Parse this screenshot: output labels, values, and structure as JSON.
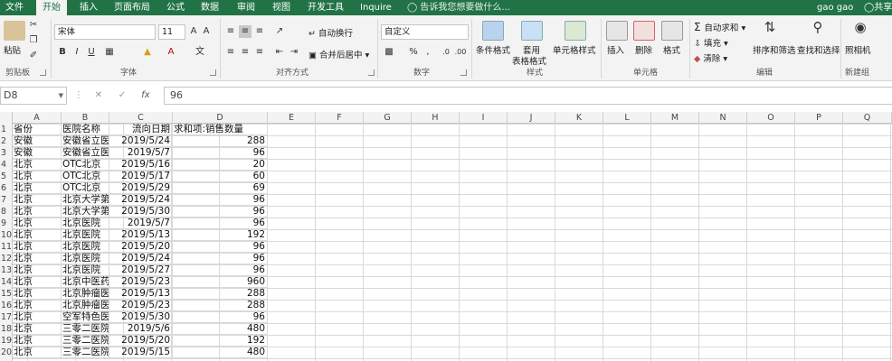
{
  "tabs": [
    "文件",
    "开始",
    "插入",
    "页面布局",
    "公式",
    "数据",
    "审阅",
    "视图",
    "开发工具",
    "Inquire"
  ],
  "tell_me": "告诉我您想要做什么...",
  "user": "gao gao",
  "share": "共享",
  "ribbon": {
    "paste": "粘贴",
    "clipboard": "剪贴板",
    "font_name": "宋体",
    "font_size": "11",
    "font_group": "字体",
    "align_group": "对齐方式",
    "wrap_text": "自动换行",
    "merge_center": "合并后居中",
    "number_format": "自定义",
    "number_group": "数字",
    "conditional": "条件格式",
    "table_fmt_1": "套用",
    "table_fmt_2": "表格格式",
    "cell_styles": "单元格样式",
    "styles_group": "样式",
    "insert": "插入",
    "delete": "删除",
    "format": "格式",
    "cells_group": "单元格",
    "autosum": "自动求和",
    "fill": "填充",
    "clear": "清除",
    "sort_filter": "排序和筛选",
    "find_select": "查找和选择",
    "editing_group": "编辑",
    "camera": "照相机",
    "newgroup": "新建组"
  },
  "namebox": "D8",
  "formula_value": "96",
  "columns": [
    "A",
    "B",
    "C",
    "D",
    "E",
    "F",
    "G",
    "H",
    "I",
    "J",
    "K",
    "L",
    "M",
    "N",
    "O",
    "P",
    "Q"
  ],
  "rows": [
    {
      "n": "1",
      "a": "省份",
      "b": "医院名称",
      "c": "流向日期",
      "d": "求和项:销售数量"
    },
    {
      "n": "2",
      "a": "安徽",
      "b": "安徽省立医",
      "c": "2019/5/24",
      "d": "288"
    },
    {
      "n": "3",
      "a": "安徽",
      "b": "安徽省立医",
      "c": "2019/5/7",
      "d": "96"
    },
    {
      "n": "4",
      "a": "北京",
      "b": "OTC北京",
      "c": "2019/5/16",
      "d": "20"
    },
    {
      "n": "5",
      "a": "北京",
      "b": "OTC北京",
      "c": "2019/5/17",
      "d": "60"
    },
    {
      "n": "6",
      "a": "北京",
      "b": "OTC北京",
      "c": "2019/5/29",
      "d": "69"
    },
    {
      "n": "7",
      "a": "北京",
      "b": "北京大学第",
      "c": "2019/5/24",
      "d": "96"
    },
    {
      "n": "8",
      "a": "北京",
      "b": "北京大学第",
      "c": "2019/5/30",
      "d": "96"
    },
    {
      "n": "9",
      "a": "北京",
      "b": "北京医院",
      "c": "2019/5/7",
      "d": "96"
    },
    {
      "n": "10",
      "a": "北京",
      "b": "北京医院",
      "c": "2019/5/13",
      "d": "192"
    },
    {
      "n": "11",
      "a": "北京",
      "b": "北京医院",
      "c": "2019/5/20",
      "d": "96"
    },
    {
      "n": "12",
      "a": "北京",
      "b": "北京医院",
      "c": "2019/5/24",
      "d": "96"
    },
    {
      "n": "13",
      "a": "北京",
      "b": "北京医院",
      "c": "2019/5/27",
      "d": "96"
    },
    {
      "n": "14",
      "a": "北京",
      "b": "北京中医药",
      "c": "2019/5/23",
      "d": "960"
    },
    {
      "n": "15",
      "a": "北京",
      "b": "北京肿瘤医",
      "c": "2019/5/13",
      "d": "288"
    },
    {
      "n": "16",
      "a": "北京",
      "b": "北京肿瘤医",
      "c": "2019/5/23",
      "d": "288"
    },
    {
      "n": "17",
      "a": "北京",
      "b": "空军特色医",
      "c": "2019/5/30",
      "d": "96"
    },
    {
      "n": "18",
      "a": "北京",
      "b": "三零二医院",
      "c": "2019/5/6",
      "d": "480"
    },
    {
      "n": "19",
      "a": "北京",
      "b": "三零二医院",
      "c": "2019/5/20",
      "d": "192"
    },
    {
      "n": "20",
      "a": "北京",
      "b": "三零二医院",
      "c": "2019/5/15",
      "d": "480"
    }
  ],
  "colors": {
    "accent": "#217346",
    "ribbon_bg": "#f3f3f3",
    "grid_line": "#d9d9d9"
  }
}
